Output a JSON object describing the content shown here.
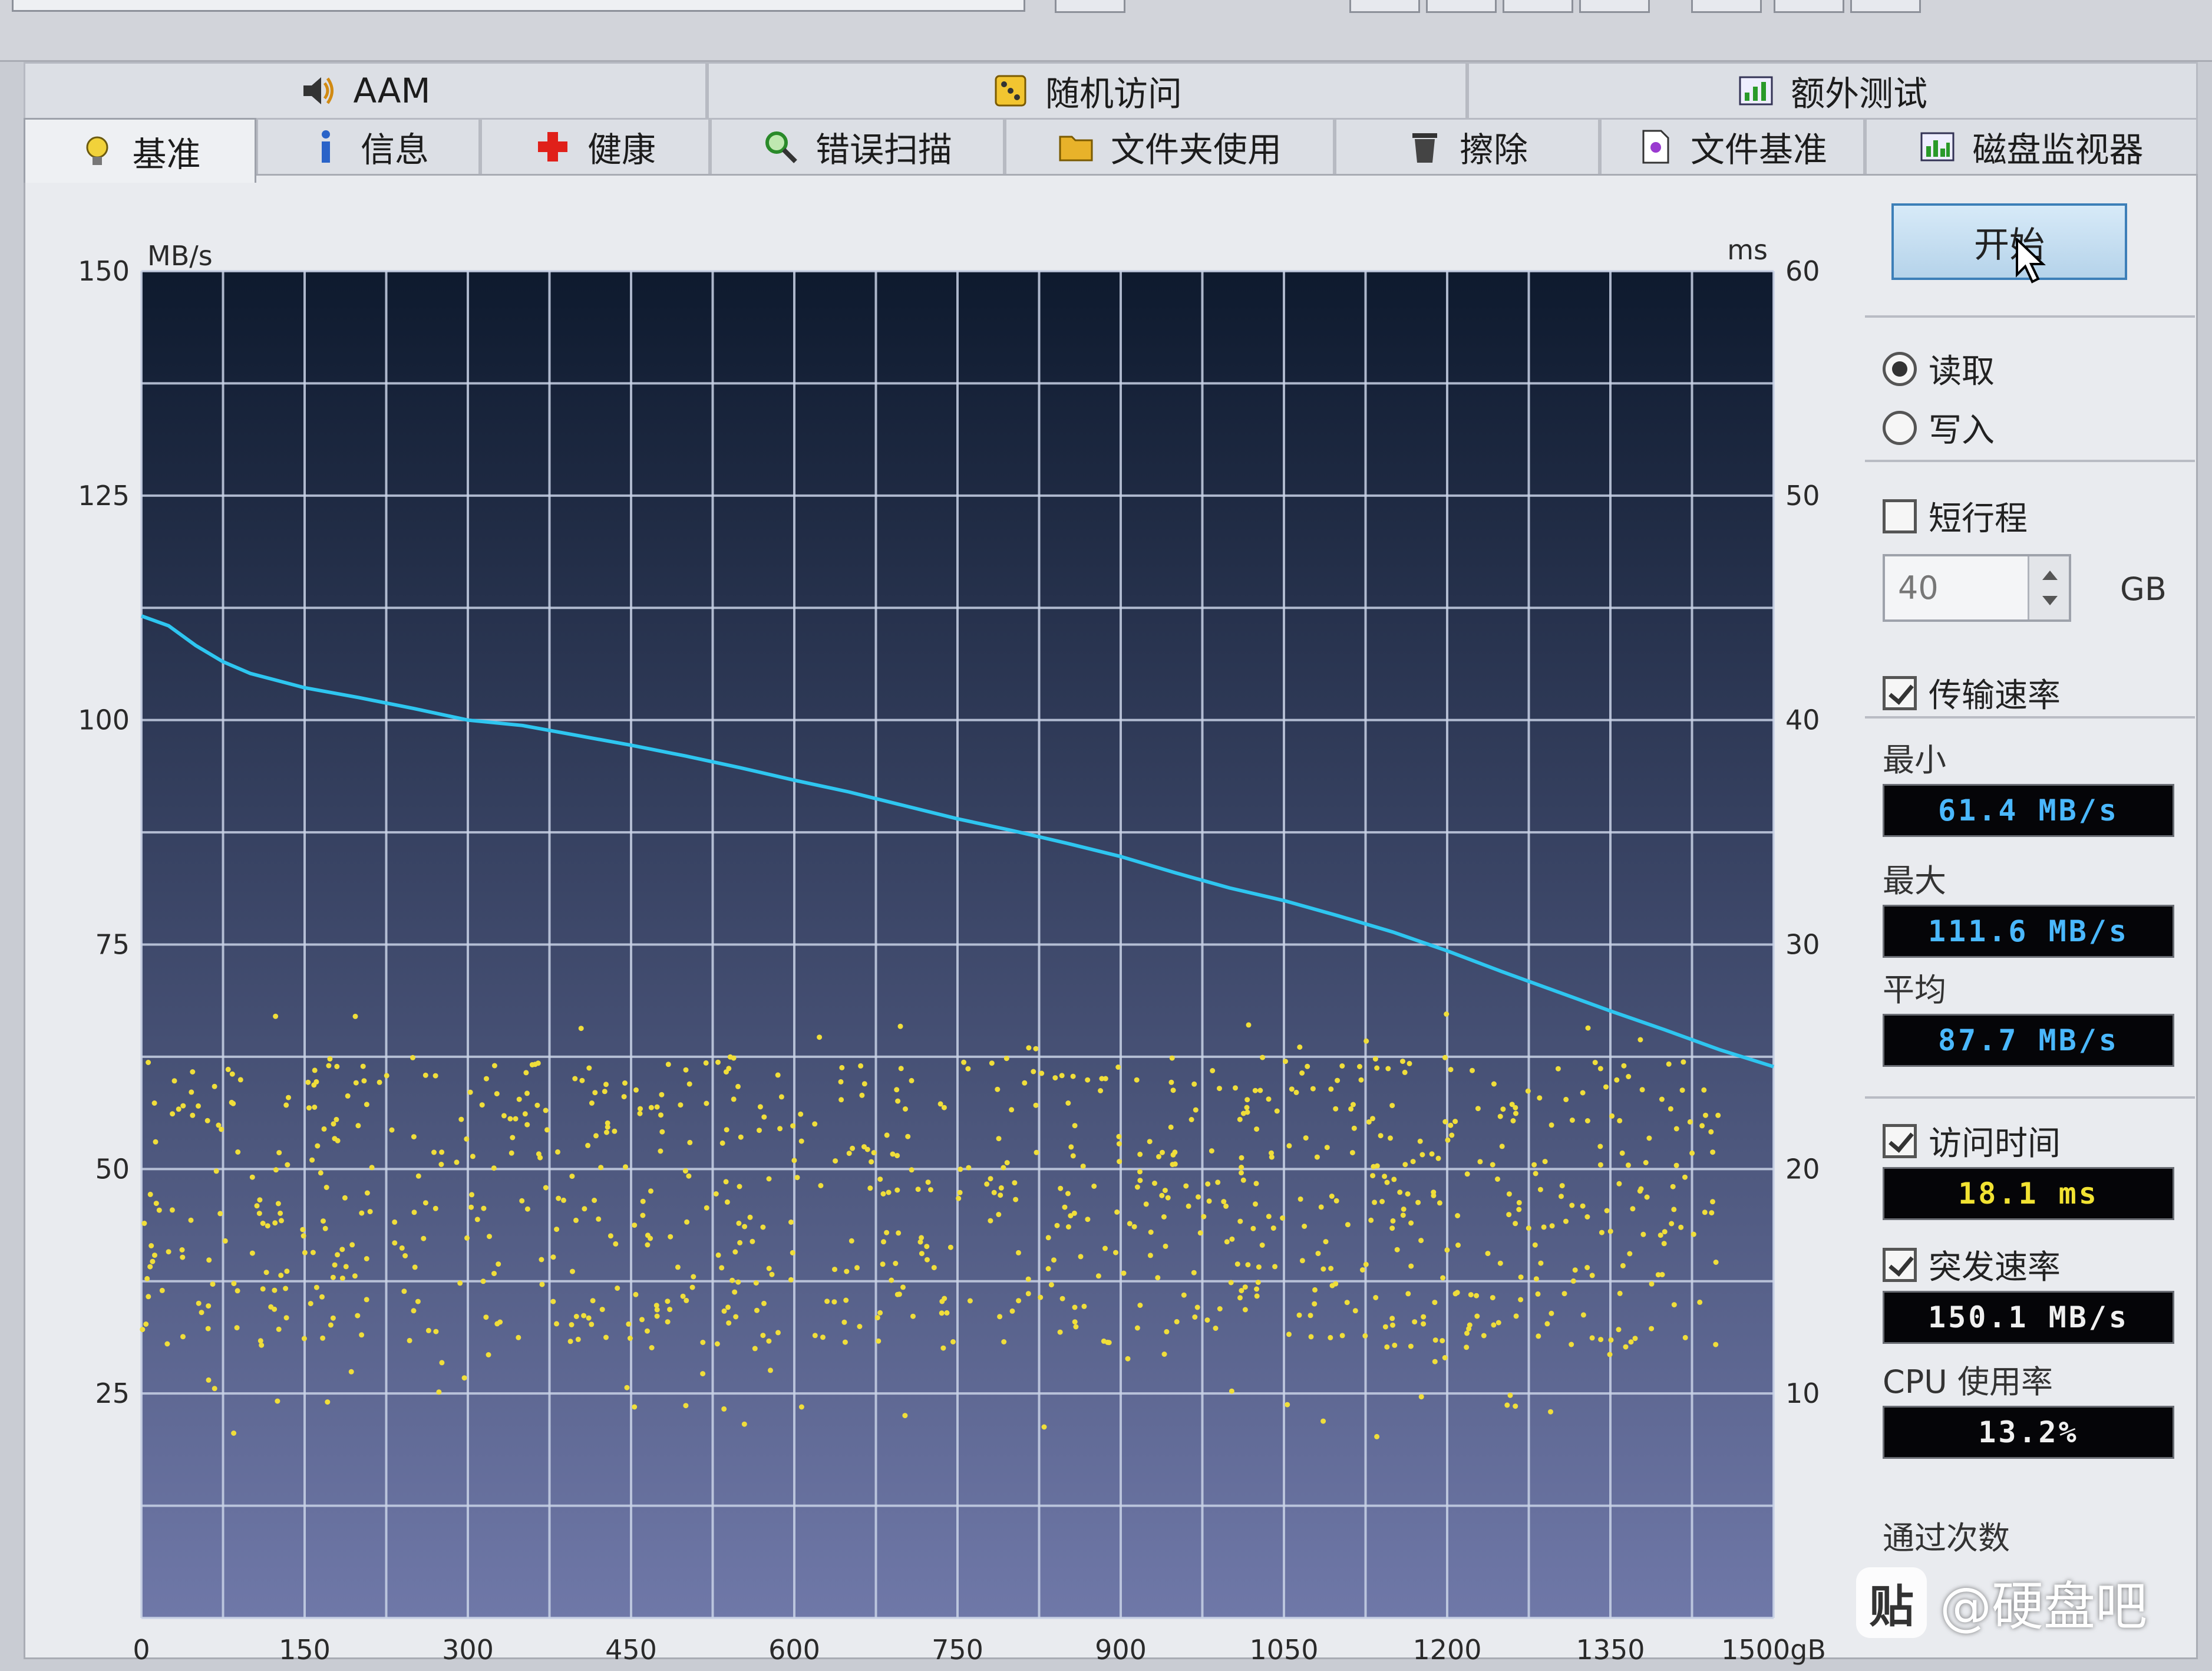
{
  "tabs_top": [
    {
      "label": "AAM",
      "icon": "speaker-icon"
    },
    {
      "label": "随机访问",
      "icon": "dice-icon"
    },
    {
      "label": "额外测试",
      "icon": "extra-test-icon"
    }
  ],
  "tabs_bottom": [
    {
      "label": "基准",
      "icon": "lightbulb-icon",
      "active": true
    },
    {
      "label": "信息",
      "icon": "info-icon"
    },
    {
      "label": "健康",
      "icon": "health-cross-icon"
    },
    {
      "label": "错误扫描",
      "icon": "magnifier-icon"
    },
    {
      "label": "文件夹使用",
      "icon": "folder-icon"
    },
    {
      "label": "擦除",
      "icon": "trash-icon"
    },
    {
      "label": "文件基准",
      "icon": "file-benchmark-icon"
    },
    {
      "label": "磁盘监视器",
      "icon": "disk-monitor-icon"
    }
  ],
  "side": {
    "start_label": "开始",
    "read_label": "读取",
    "write_label": "写入",
    "mode": "read",
    "short_stroke_label": "短行程",
    "short_stroke_checked": false,
    "short_stroke_value": "40",
    "short_stroke_unit": "GB",
    "transfer_rate_label": "传输速率",
    "transfer_rate_checked": true,
    "min_label": "最小",
    "min_value": "61.4 MB/s",
    "max_label": "最大",
    "max_value": "111.6 MB/s",
    "avg_label": "平均",
    "avg_value": "87.7 MB/s",
    "access_time_label": "访问时间",
    "access_time_checked": true,
    "access_time_value": "18.1 ms",
    "burst_rate_label": "突发速率",
    "burst_rate_checked": true,
    "burst_rate_value": "150.1 MB/s",
    "cpu_label": "CPU 使用率",
    "cpu_value": "13.2%",
    "passes_label": "通过次数"
  },
  "watermark": {
    "logo_text": "贴",
    "text": "@硬盘吧"
  },
  "colors": {
    "plot_bg_top": "#0e1a2e",
    "plot_bg_bottom": "#6f78a8",
    "grid": "#c9d2e6",
    "transfer_line": "#2ec6f0",
    "access_points": "#f0de3a"
  },
  "chart_data": {
    "type": "line",
    "title": "",
    "left_axis_unit": "MB/s",
    "right_axis_unit": "ms",
    "x_unit": "gB",
    "x_ticks": [
      0,
      150,
      300,
      450,
      600,
      750,
      900,
      1050,
      1200,
      1350,
      1500
    ],
    "x_tick_labels": [
      "0",
      "150",
      "300",
      "450",
      "600",
      "750",
      "900",
      "1050",
      "1200",
      "1350",
      "1500gB"
    ],
    "y_left_ticks": [
      25,
      50,
      75,
      100,
      125,
      150
    ],
    "y_right_ticks": [
      10,
      20,
      30,
      40,
      50,
      60
    ],
    "xlim": [
      0,
      1500
    ],
    "ylim_left": [
      0,
      150
    ],
    "ylim_right": [
      0,
      60
    ],
    "grid": true,
    "series": [
      {
        "axis": "left",
        "style": "line",
        "x": [
          0,
          25,
          50,
          75,
          100,
          150,
          200,
          250,
          300,
          350,
          400,
          450,
          500,
          550,
          600,
          650,
          700,
          750,
          800,
          850,
          900,
          950,
          1000,
          1050,
          1100,
          1150,
          1200,
          1250,
          1300,
          1350,
          1400,
          1450,
          1500
        ],
        "y": [
          111.6,
          110.5,
          108.3,
          106.5,
          105.2,
          103.6,
          102.5,
          101.3,
          100.0,
          99.4,
          98.3,
          97.2,
          96.0,
          94.7,
          93.3,
          92.0,
          90.5,
          89.0,
          87.7,
          86.3,
          84.8,
          83.0,
          81.3,
          79.9,
          78.2,
          76.4,
          74.3,
          72.0,
          69.8,
          67.6,
          65.5,
          63.3,
          61.4
        ]
      },
      {
        "axis": "right",
        "style": "scatter",
        "x_range": [
          0,
          1450
        ],
        "y_range": [
          8,
          27
        ],
        "typical_range": [
          12,
          25
        ],
        "point_count": 900
      }
    ]
  }
}
